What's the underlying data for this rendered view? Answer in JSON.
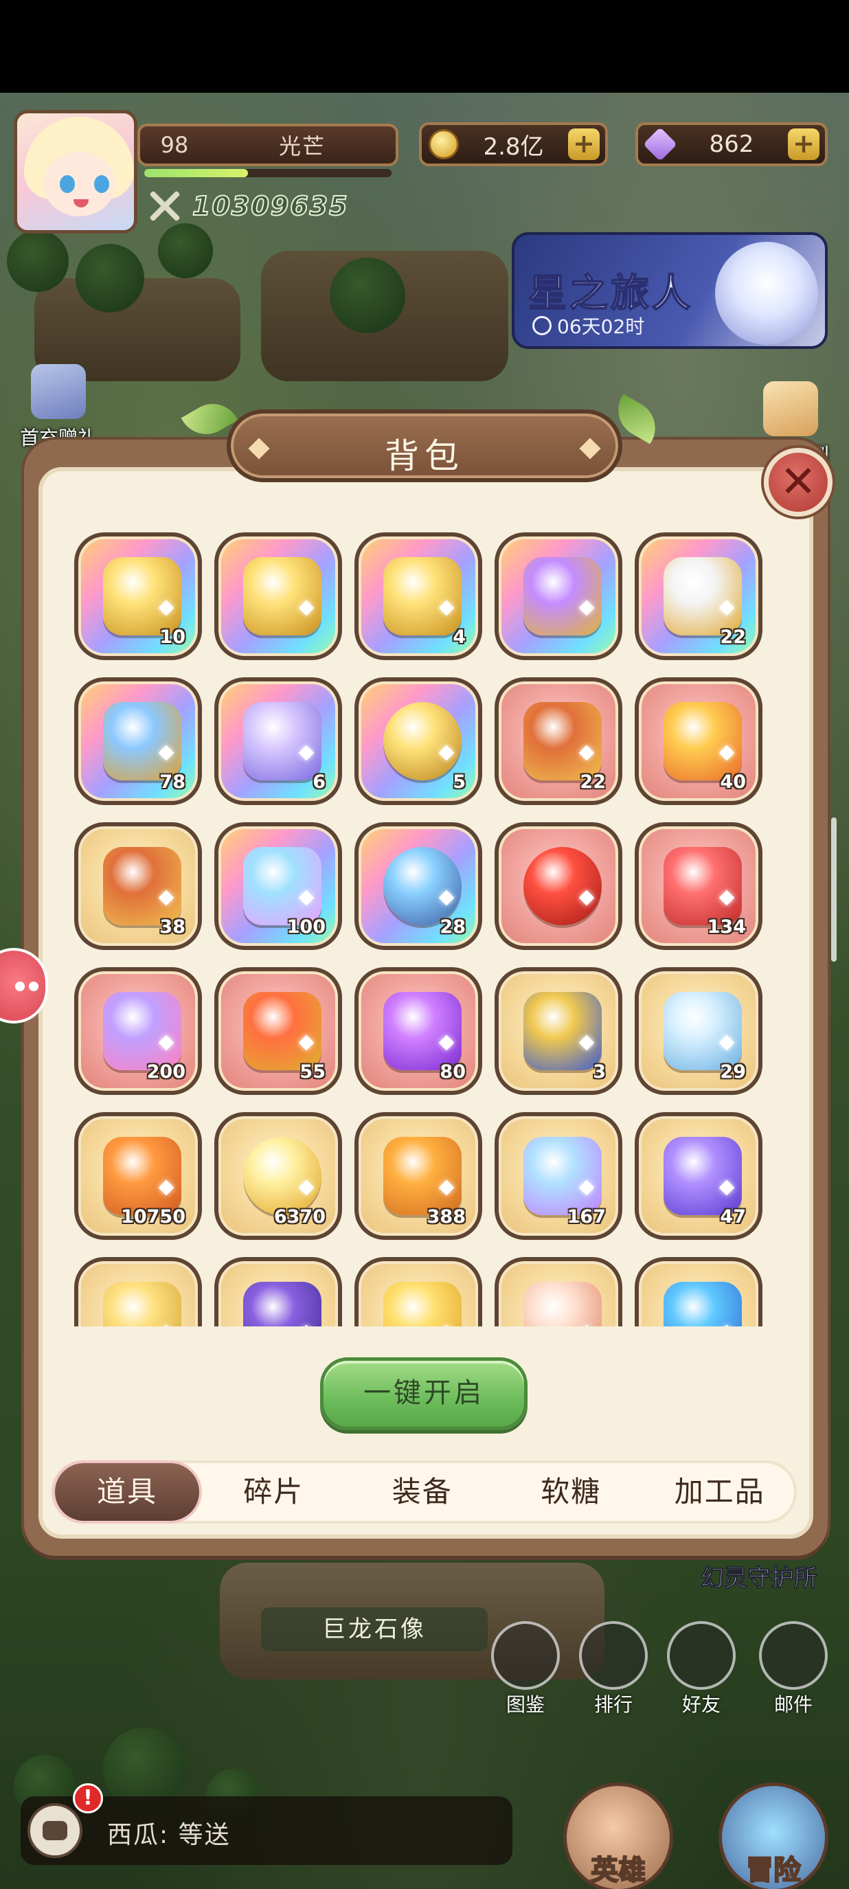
{
  "hud": {
    "level": "98",
    "player_name": "光芒",
    "power": "10309635",
    "gold": "2.8亿",
    "gems": "862",
    "plus_icon": "+",
    "xp_progress": 0.42
  },
  "event": {
    "title": "星之旅人",
    "time_left": "06天02时"
  },
  "side": {
    "first_recharge_label": "首充赠礼",
    "daily_label": "每日签到"
  },
  "modal": {
    "title": "背包",
    "close_glyph": "✕",
    "open_all_label": "一键开启",
    "tabs": [
      "道具",
      "碎片",
      "装备",
      "软糖",
      "加工品"
    ],
    "active_tab": 0,
    "items": [
      {
        "count": "10",
        "bg": "rainbow",
        "icon": "golden-chest-icon"
      },
      {
        "count": "",
        "bg": "rainbow",
        "icon": "golden-chest-icon"
      },
      {
        "count": "4",
        "bg": "rainbow",
        "icon": "golden-chest-icon"
      },
      {
        "count": "",
        "bg": "rainbow",
        "icon": "purple-chest-icon"
      },
      {
        "count": "22",
        "bg": "rainbow",
        "icon": "silver-chest-icon"
      },
      {
        "count": "78",
        "bg": "rainbow",
        "icon": "jeweled-chest-icon"
      },
      {
        "count": "6",
        "bg": "rainbow",
        "icon": "cookie-figure-icon"
      },
      {
        "count": "5",
        "bg": "rainbow",
        "icon": "golden-ring-icon"
      },
      {
        "count": "22",
        "bg": "red",
        "icon": "treasure-chest-icon"
      },
      {
        "count": "40",
        "bg": "red",
        "icon": "gold-shard-icon"
      },
      {
        "count": "38",
        "bg": "gold",
        "icon": "treasure-chest-icon"
      },
      {
        "count": "100",
        "bg": "rainbow",
        "icon": "rainbow-shard-icon"
      },
      {
        "count": "28",
        "bg": "rainbow",
        "icon": "gear-ring-icon"
      },
      {
        "count": "",
        "bg": "red",
        "icon": "red-orb-icon"
      },
      {
        "count": "134",
        "bg": "red",
        "icon": "red-shard-icon"
      },
      {
        "count": "200",
        "bg": "red",
        "icon": "candy-hat-icon"
      },
      {
        "count": "55",
        "bg": "red",
        "icon": "heart-gem-icon"
      },
      {
        "count": "80",
        "bg": "red",
        "icon": "potion-bottle-icon"
      },
      {
        "count": "3",
        "bg": "gold",
        "icon": "jewel-cube-icon"
      },
      {
        "count": "29",
        "bg": "gold",
        "icon": "snowflake-icon"
      },
      {
        "count": "10750",
        "bg": "gold",
        "icon": "scroll-card-icon"
      },
      {
        "count": "6370",
        "bg": "gold",
        "icon": "gold-coin-icon"
      },
      {
        "count": "388",
        "bg": "gold",
        "icon": "gold-puzzle-icon"
      },
      {
        "count": "167",
        "bg": "gold",
        "icon": "crystal-crown-icon"
      },
      {
        "count": "47",
        "bg": "gold",
        "icon": "purple-ticket-icon"
      },
      {
        "count": "",
        "bg": "gold",
        "icon": "gold-key-icon"
      },
      {
        "count": "",
        "bg": "gold",
        "icon": "magic-card-icon"
      },
      {
        "count": "",
        "bg": "gold",
        "icon": "feather-icon"
      },
      {
        "count": "",
        "bg": "gold",
        "icon": "tower-ticket-icon"
      },
      {
        "count": "",
        "bg": "gold",
        "icon": "blue-stone-icon"
      }
    ]
  },
  "bottom": {
    "statue_label": "巨龙石像",
    "guard_label": "幻灵守护所",
    "buttons": [
      "图鉴",
      "排行",
      "好友",
      "邮件"
    ],
    "chat_badge": "!",
    "chat_message": "西瓜: 等送",
    "hero_label": "英雄",
    "adventure_label": "冒险"
  }
}
